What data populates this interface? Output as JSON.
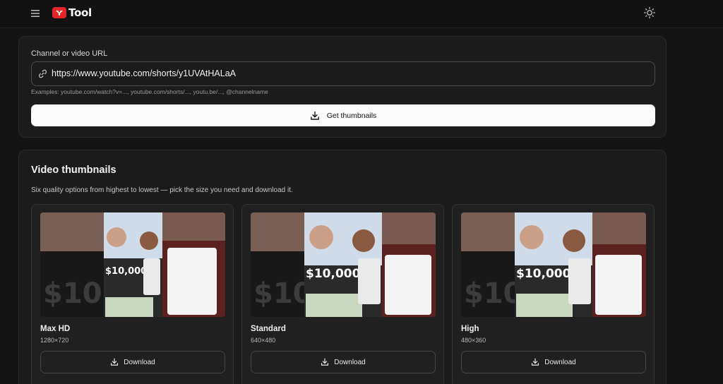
{
  "header": {
    "logo_text": "Tool",
    "menu_icon": "menu-icon",
    "theme_icon": "sun-icon"
  },
  "url_form": {
    "label": "Channel or video URL",
    "value": "https://www.youtube.com/shorts/y1UVAtHALaA",
    "hint": "Examples: youtube.com/watch?v=..., youtube.com/shorts/..., youtu.be/..., @channelname",
    "submit_label": "Get thumbnails"
  },
  "thumbnails": {
    "title": "Video thumbnails",
    "description": "Six quality options from highest to lowest — pick the size you need and download it.",
    "items": [
      {
        "name": "Max HD",
        "resolution": "1280×720",
        "download_label": "Download",
        "overlay": "$10,000",
        "big_text": "$10,0"
      },
      {
        "name": "Standard",
        "resolution": "640×480",
        "download_label": "Download",
        "overlay": "$10,000",
        "big_text": "$10,"
      },
      {
        "name": "High",
        "resolution": "480×360",
        "download_label": "Download",
        "overlay": "$10,000",
        "big_text": "$10,("
      }
    ]
  },
  "colors": {
    "background": "#141414",
    "card": "#1b1b1b",
    "brand_red": "#e5252a",
    "primary_button": "#fafafa"
  }
}
